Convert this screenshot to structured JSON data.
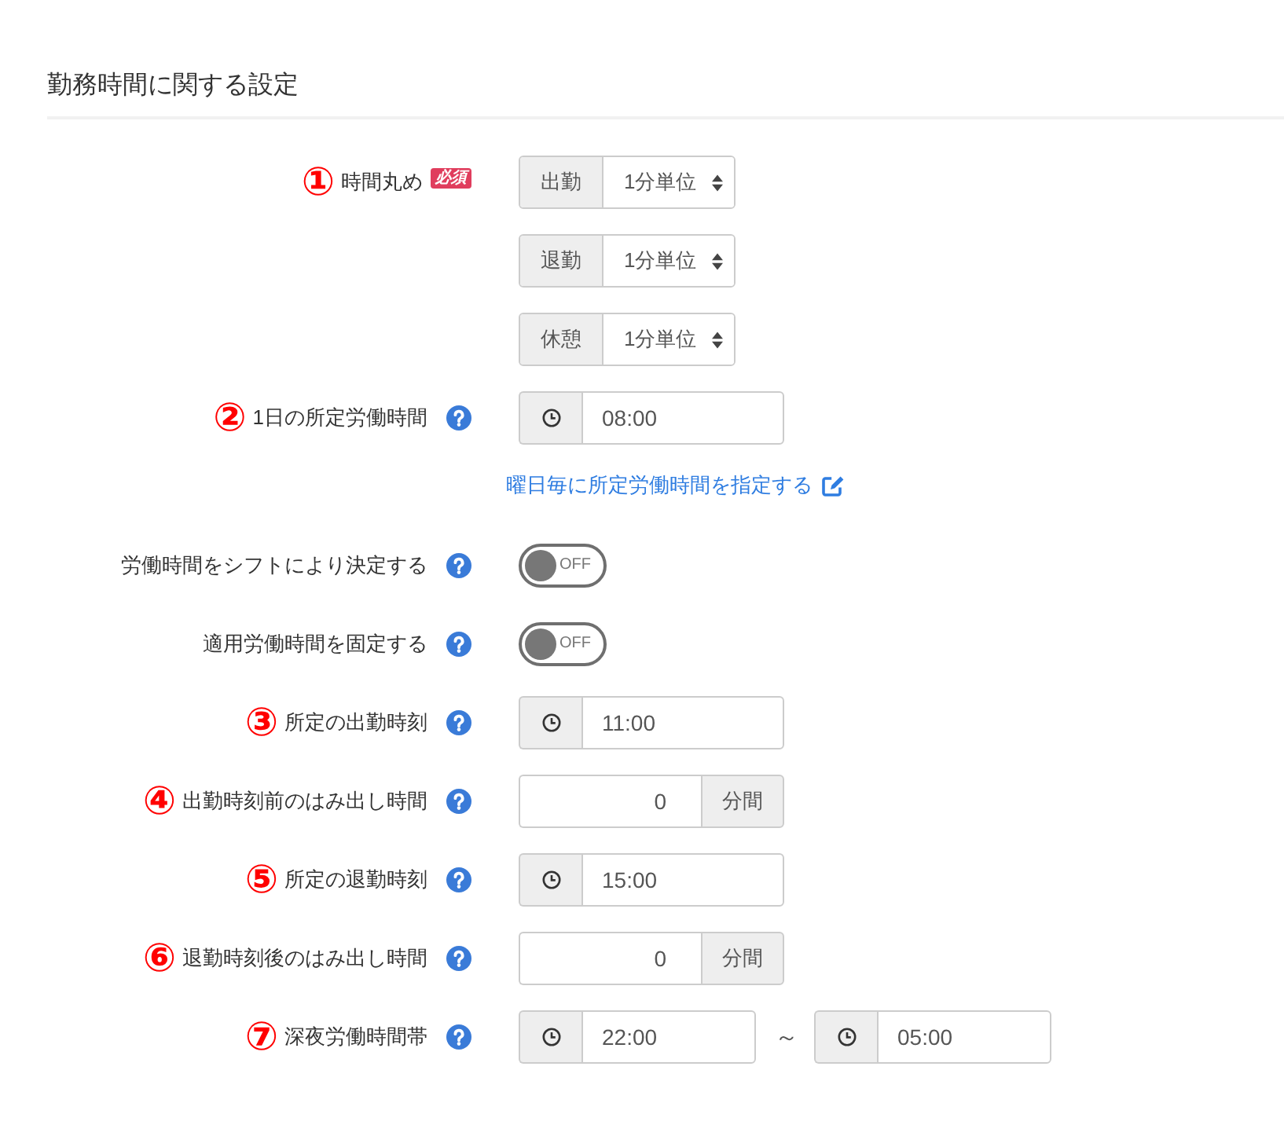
{
  "section": {
    "title": "勤務時間に関する設定"
  },
  "fields": [
    {
      "kind": "rounding",
      "number": "①",
      "label": "時間丸め",
      "required_badge": "必須",
      "selects": [
        {
          "prefix": "出勤",
          "value": "1分単位"
        },
        {
          "prefix": "退勤",
          "value": "1分単位"
        },
        {
          "prefix": "休憩",
          "value": "1分単位"
        }
      ]
    },
    {
      "kind": "time",
      "number": "②",
      "label": "1日の所定労働時間",
      "help": true,
      "value": "08:00",
      "link": "曜日毎に所定労働時間を指定する"
    },
    {
      "kind": "toggle",
      "label": "労働時間をシフトにより決定する",
      "help": true,
      "on": false,
      "state_text": "OFF"
    },
    {
      "kind": "toggle",
      "label": "適用労働時間を固定する",
      "help": true,
      "on": false,
      "state_text": "OFF"
    },
    {
      "kind": "time",
      "number": "③",
      "label": "所定の出勤時刻",
      "help": true,
      "value": "11:00"
    },
    {
      "kind": "minutes",
      "number": "④",
      "label": "出勤時刻前のはみ出し時間",
      "help": true,
      "value": "0",
      "unit": "分間"
    },
    {
      "kind": "time",
      "number": "⑤",
      "label": "所定の退勤時刻",
      "help": true,
      "value": "15:00"
    },
    {
      "kind": "minutes",
      "number": "⑥",
      "label": "退勤時刻後のはみ出し時間",
      "help": true,
      "value": "0",
      "unit": "分間"
    },
    {
      "kind": "time_range",
      "number": "⑦",
      "label": "深夜労働時間帯",
      "help": true,
      "from": "22:00",
      "separator": "～",
      "to": "05:00"
    }
  ]
}
